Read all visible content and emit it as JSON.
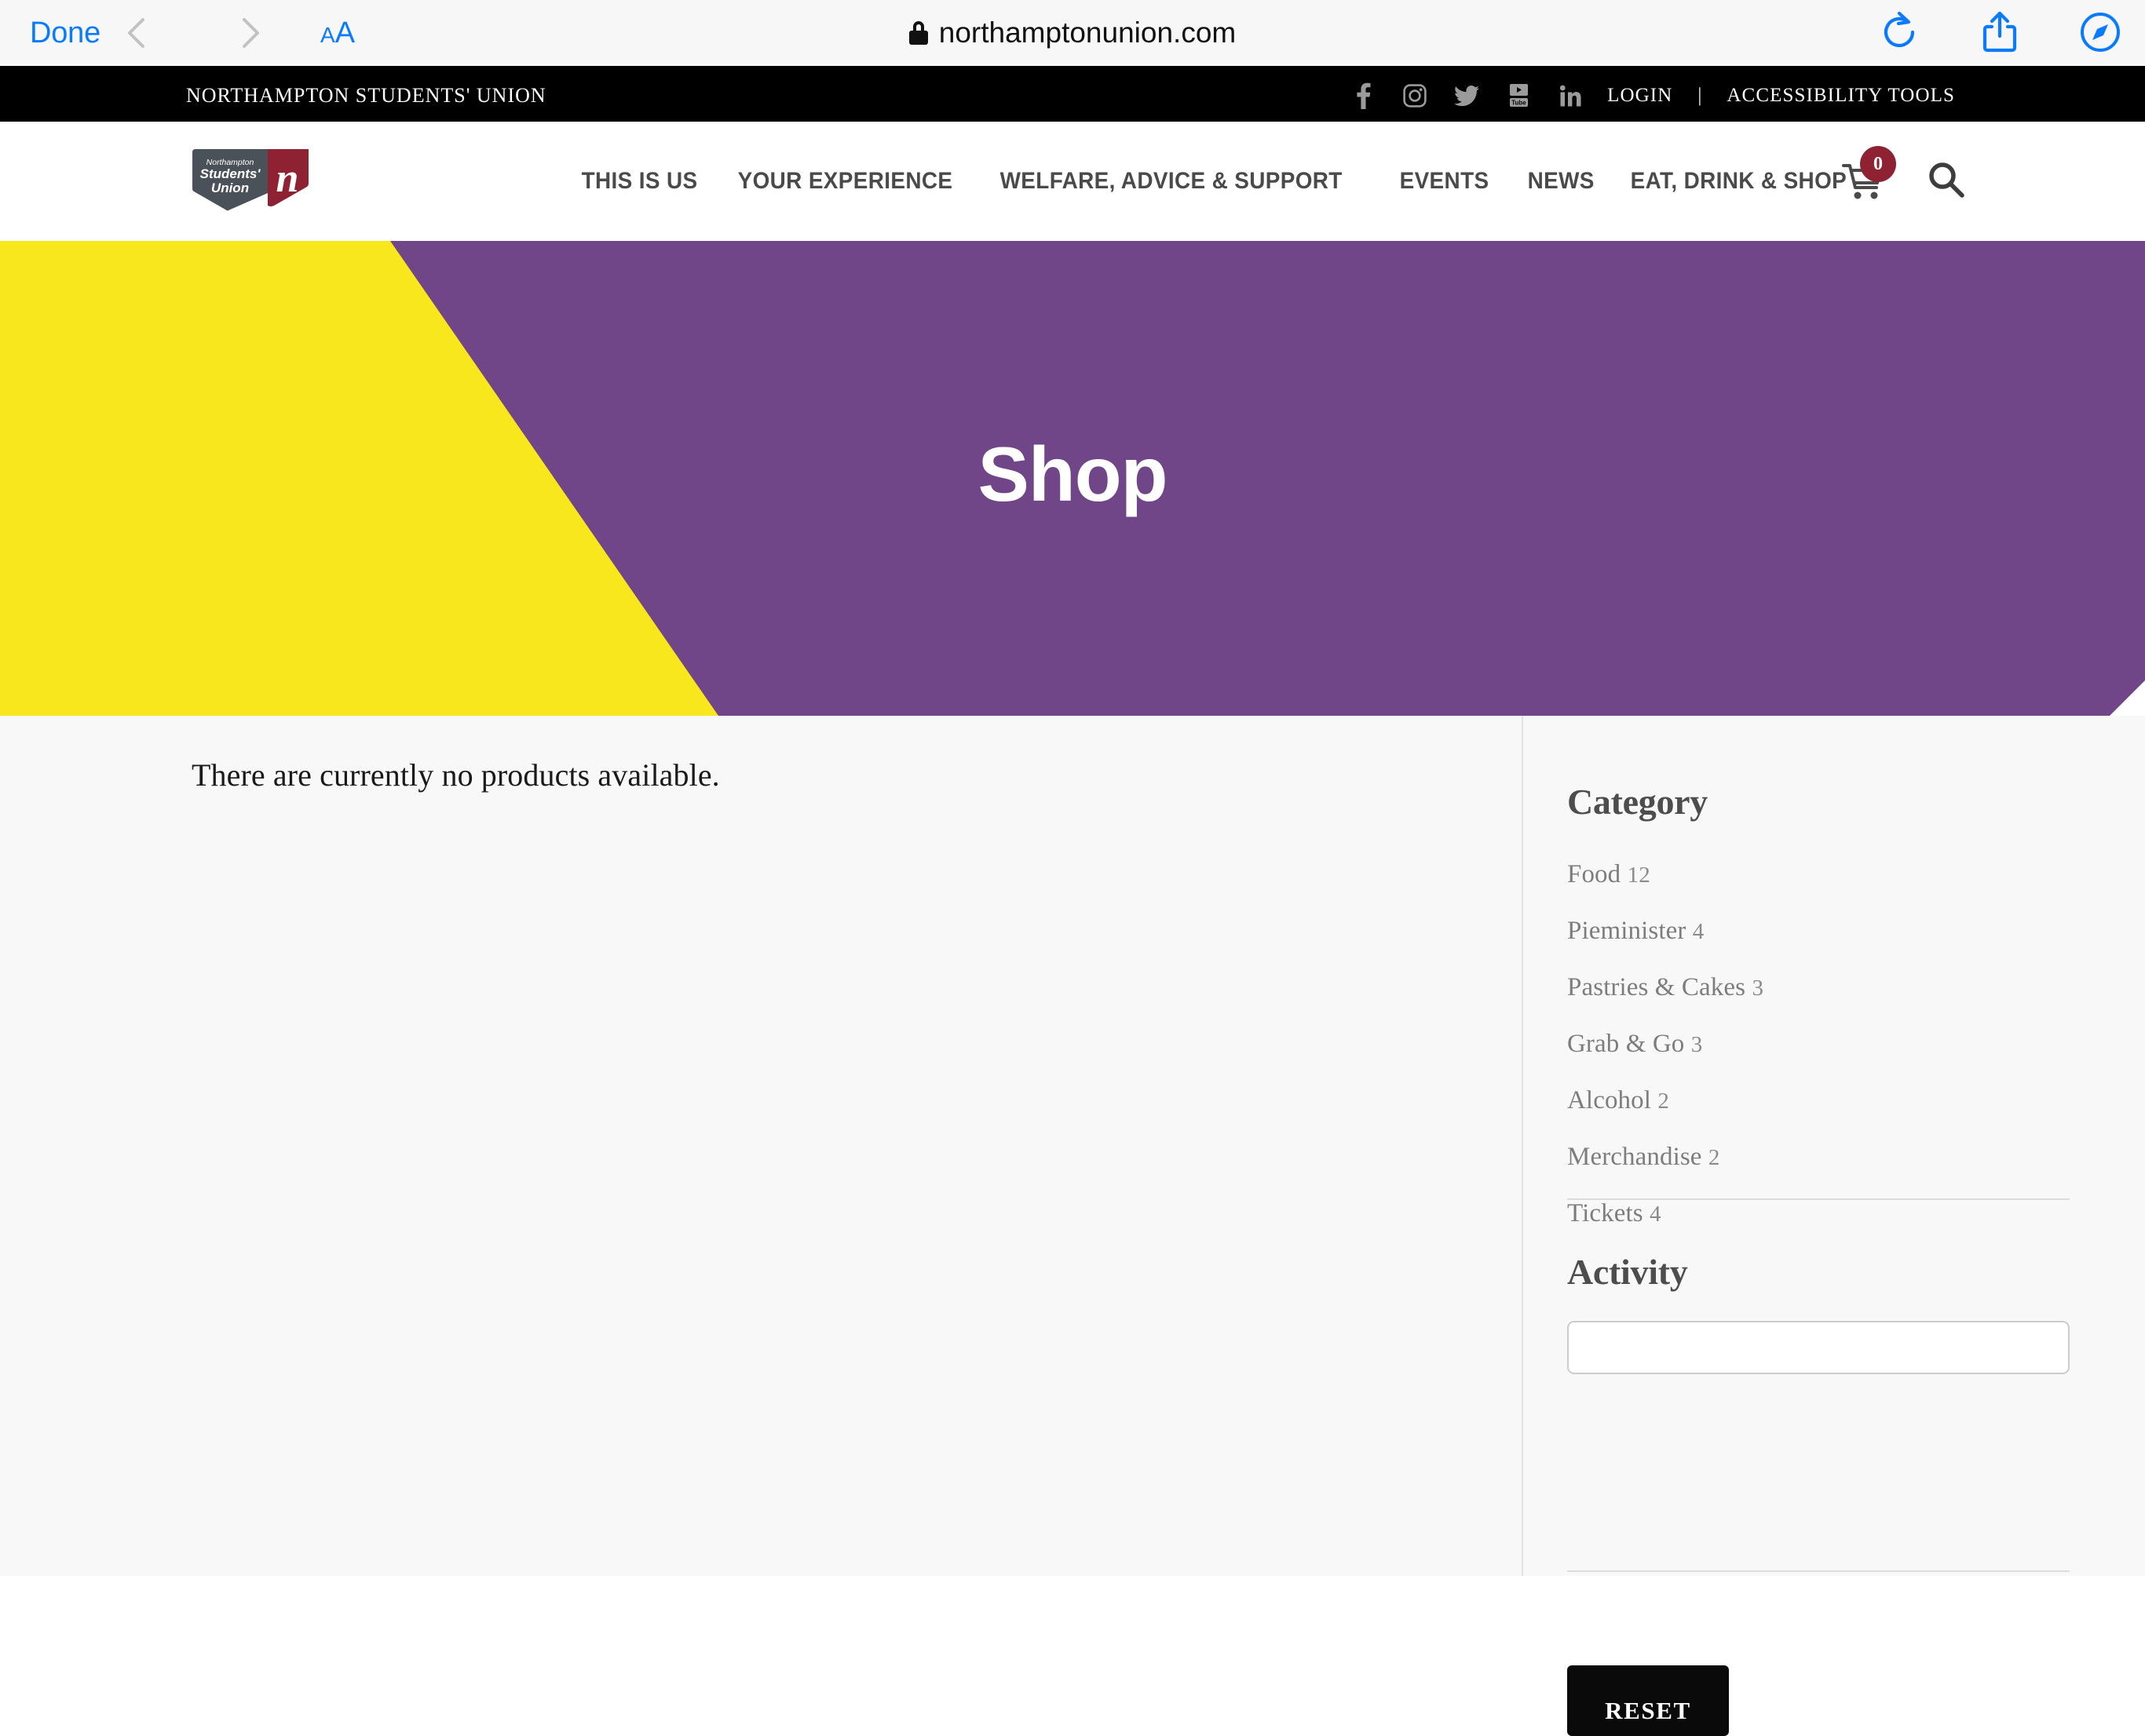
{
  "browser": {
    "done_label": "Done",
    "back_icon": "chevron-left-icon",
    "forward_icon": "chevron-right-icon",
    "text_size_small": "A",
    "text_size_large": "A",
    "url": "northamptonunion.com",
    "lock_icon": "lock-icon",
    "reload_icon": "reload-icon",
    "share_icon": "share-icon",
    "tabs_icon": "compass-icon"
  },
  "topbar": {
    "brand": "NORTHAMPTON STUDENTS' UNION",
    "social": [
      {
        "name": "facebook-icon",
        "label": "Facebook"
      },
      {
        "name": "instagram-icon",
        "label": "Instagram"
      },
      {
        "name": "twitter-icon",
        "label": "Twitter"
      },
      {
        "name": "youtube-icon",
        "label": "YouTube"
      },
      {
        "name": "linkedin-icon",
        "label": "LinkedIn"
      }
    ],
    "login_label": "LOGIN",
    "separator": "|",
    "accessibility_label": "ACCESSIBILITY TOOLS"
  },
  "logo": {
    "line1": "Northampton",
    "line2": "Students'",
    "line3": "Union",
    "mark": "n",
    "dark_color": "#4a5159",
    "red_color": "#8e2233"
  },
  "nav": {
    "items": [
      {
        "label": "THIS IS US"
      },
      {
        "label": "YOUR EXPERIENCE"
      },
      {
        "label": "WELFARE, ADVICE & SUPPORT"
      },
      {
        "label": "EVENTS"
      },
      {
        "label": "NEWS"
      },
      {
        "label": "EAT, DRINK & SHOP"
      }
    ]
  },
  "header_actions": {
    "cart_icon": "shopping-cart-icon",
    "cart_count": "0",
    "search_icon": "search-icon"
  },
  "hero": {
    "title": "Shop",
    "purple": "#714689",
    "yellow": "#f8e71c"
  },
  "main": {
    "empty_message": "There are currently no products available."
  },
  "sidebar": {
    "category_heading": "Category",
    "categories": [
      {
        "label": "Food",
        "count": "12"
      },
      {
        "label": "Pieminister",
        "count": "4"
      },
      {
        "label": "Pastries & Cakes",
        "count": "3"
      },
      {
        "label": "Grab & Go",
        "count": "3"
      },
      {
        "label": "Alcohol",
        "count": "2"
      },
      {
        "label": "Merchandise",
        "count": "2"
      },
      {
        "label": "Tickets",
        "count": "4"
      }
    ],
    "activity_heading": "Activity",
    "activity_value": "",
    "activity_placeholder": "",
    "reset_label": "RESET"
  }
}
